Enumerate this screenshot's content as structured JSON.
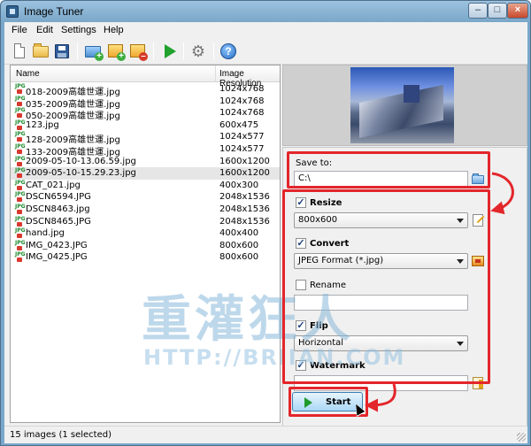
{
  "window": {
    "title": "Image Tuner"
  },
  "menu": [
    "File",
    "Edit",
    "Settings",
    "Help"
  ],
  "toolbar": {
    "icons": [
      "new-icon",
      "open-folder-icon",
      "save-icon",
      "add-folder-icon",
      "add-image-icon",
      "remove-image-icon",
      "start-icon",
      "settings-icon",
      "help-icon"
    ]
  },
  "filelist": {
    "columns": [
      "Name",
      "Image Resolution"
    ],
    "rows": [
      {
        "name": "018-2009高雄世運.jpg",
        "res": "1024x768"
      },
      {
        "name": "035-2009高雄世運.jpg",
        "res": "1024x768"
      },
      {
        "name": "050-2009高雄世運.jpg",
        "res": "1024x768"
      },
      {
        "name": "123.jpg",
        "res": "600x475"
      },
      {
        "name": "128-2009高雄世運.jpg",
        "res": "1024x577"
      },
      {
        "name": "133-2009高雄世運.jpg",
        "res": "1024x577"
      },
      {
        "name": "2009-05-10-13.06.59.jpg",
        "res": "1600x1200"
      },
      {
        "name": "2009-05-10-15.29.23.jpg",
        "res": "1600x1200"
      },
      {
        "name": "CAT_021.jpg",
        "res": "400x300"
      },
      {
        "name": "DSCN6594.JPG",
        "res": "2048x1536"
      },
      {
        "name": "DSCN8463.jpg",
        "res": "2048x1536"
      },
      {
        "name": "DSCN8465.JPG",
        "res": "2048x1536"
      },
      {
        "name": "hand.jpg",
        "res": "400x400"
      },
      {
        "name": "IMG_0423.JPG",
        "res": "800x600"
      },
      {
        "name": "IMG_0425.JPG",
        "res": "800x600"
      }
    ],
    "selected_index": 7
  },
  "settings": {
    "save_to_label": "Save to:",
    "save_to_value": "C:\\",
    "resize": {
      "label": "Resize",
      "checked": true,
      "value": "800x600"
    },
    "convert": {
      "label": "Convert",
      "checked": true,
      "value": "JPEG Format (*.jpg)"
    },
    "rename": {
      "label": "Rename",
      "checked": false,
      "value": ""
    },
    "flip": {
      "label": "Flip",
      "checked": true,
      "value": "Horizontal"
    },
    "watermark": {
      "label": "Watermark",
      "checked": true,
      "value": ""
    }
  },
  "start_label": "Start",
  "status": "15 images (1 selected)",
  "overlay": {
    "big": "重灌狂人",
    "url": "HTTP://BRIIAN.COM"
  },
  "colors": {
    "highlight": "#e3262b",
    "title_bar": "#7aa7c9",
    "selection": "#e6e6e6"
  }
}
